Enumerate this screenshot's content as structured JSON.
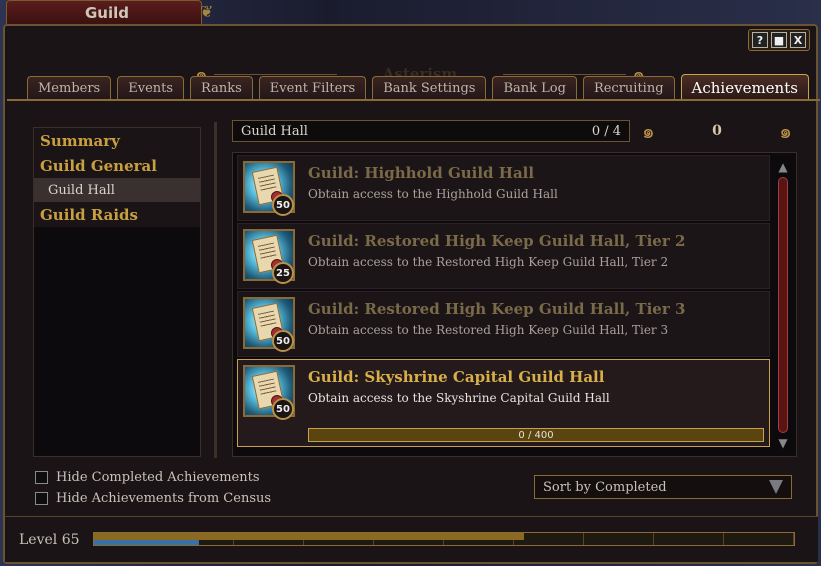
{
  "window": {
    "title": "Guild",
    "guild_name": "Asterism",
    "controls": [
      "?",
      "■",
      "X"
    ]
  },
  "tabs": [
    {
      "label": "Members"
    },
    {
      "label": "Events"
    },
    {
      "label": "Ranks"
    },
    {
      "label": "Event Filters"
    },
    {
      "label": "Bank Settings"
    },
    {
      "label": "Bank Log"
    },
    {
      "label": "Recruiting"
    },
    {
      "label": "Achievements",
      "active": true
    }
  ],
  "categories": {
    "summary": "Summary",
    "guild_general": "Guild General",
    "guild_hall": "Guild Hall",
    "guild_raids": "Guild Raids"
  },
  "category_bar": {
    "label": "Guild Hall",
    "count": "0 / 4"
  },
  "points": "0",
  "achievements": [
    {
      "title": "Guild: Highhold Guild Hall",
      "desc": "Obtain access to the Highhold Guild Hall",
      "points": "50"
    },
    {
      "title": "Guild: Restored High Keep Guild Hall, Tier 2",
      "desc": "Obtain access to the Restored High Keep Guild Hall, Tier 2",
      "points": "25"
    },
    {
      "title": "Guild: Restored High Keep Guild Hall, Tier 3",
      "desc": "Obtain access to the Restored High Keep Guild Hall, Tier 3",
      "points": "50"
    },
    {
      "title": "Guild: Skyshrine Capital Guild Hall",
      "desc": "Obtain access to the Skyshrine Capital Guild Hall",
      "points": "50",
      "progress_text": "0 / 400",
      "progress_value": 0,
      "progress_max": 400
    }
  ],
  "options": {
    "hide_completed": "Hide Completed Achievements",
    "hide_census": "Hide Achievements from Census"
  },
  "sort": {
    "selected": "Sort by Completed"
  },
  "level": {
    "label": "Level 65"
  },
  "icons": {
    "help": "help-icon",
    "minimize": "minimize-icon",
    "close": "close-icon",
    "achievement": "scroll-icon",
    "dropdown": "chevron-down-icon"
  },
  "colors": {
    "gold": "#c9a040",
    "frame": "#8a6a35",
    "progress": "#e0a020",
    "xp_blue": "#3a70a8"
  }
}
